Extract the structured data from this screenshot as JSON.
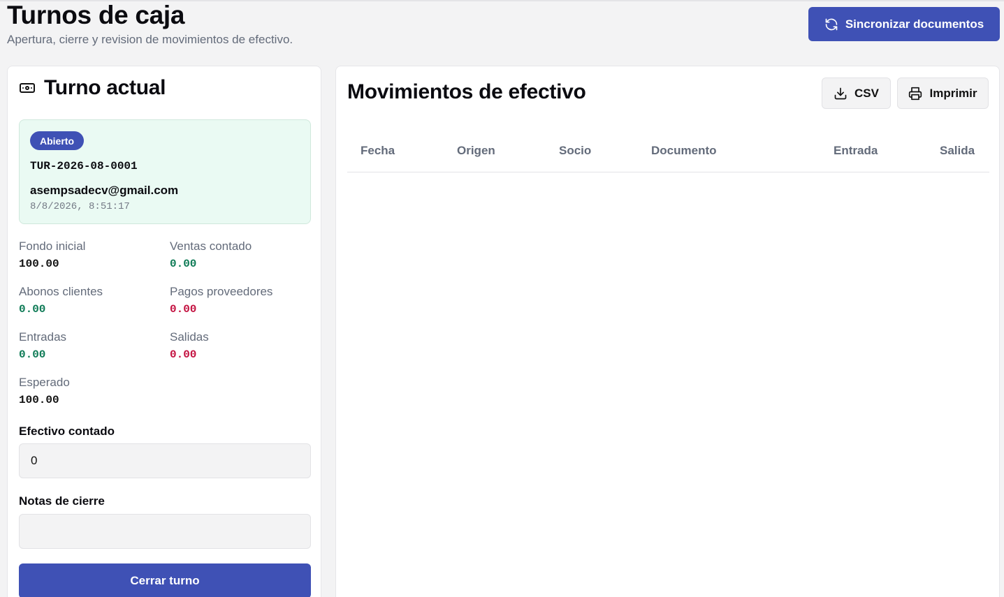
{
  "header": {
    "title": "Turnos de caja",
    "subtitle": "Apertura, cierre y revision de movimientos de efectivo.",
    "sync_label": "Sincronizar documentos"
  },
  "current_shift": {
    "title": "Turno actual",
    "status": "Abierto",
    "code": "TUR-2026-08-0001",
    "user": "asempsadecv@gmail.com",
    "opened_at": "8/8/2026, 8:51:17",
    "stats": {
      "fondo_inicial": {
        "label": "Fondo inicial",
        "value": "100.00"
      },
      "ventas_contado": {
        "label": "Ventas contado",
        "value": "0.00"
      },
      "abonos_clientes": {
        "label": "Abonos clientes",
        "value": "0.00"
      },
      "pagos_proveedores": {
        "label": "Pagos proveedores",
        "value": "0.00"
      },
      "entradas": {
        "label": "Entradas",
        "value": "0.00"
      },
      "salidas": {
        "label": "Salidas",
        "value": "0.00"
      },
      "esperado": {
        "label": "Esperado",
        "value": "100.00"
      }
    },
    "cash_counted": {
      "label": "Efectivo contado",
      "value": "0"
    },
    "closing_notes": {
      "label": "Notas de cierre",
      "value": ""
    },
    "close_label": "Cerrar turno"
  },
  "movements": {
    "title": "Movimientos de efectivo",
    "csv_label": "CSV",
    "print_label": "Imprimir",
    "columns": [
      "Fecha",
      "Origen",
      "Socio",
      "Documento",
      "Entrada",
      "Salida"
    ],
    "rows": []
  },
  "colors": {
    "accent": "#3f51b5",
    "positive": "#0d7a55",
    "negative": "#c3103f",
    "shift_bg": "#eafaf3"
  }
}
